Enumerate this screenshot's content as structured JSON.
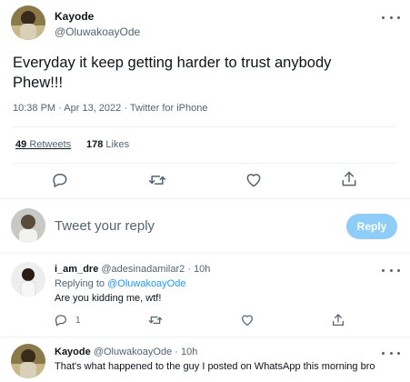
{
  "main_tweet": {
    "display_name": "Kayode",
    "handle": "@OluwakoayOde",
    "text_line1": "Everyday it keep getting harder to trust anybody",
    "text_line2": "Phew!!!",
    "time": "10:38 PM",
    "date": "Apr 13, 2022",
    "source": "Twitter for iPhone",
    "retweets_count": "49",
    "retweets_label": "Retweets",
    "likes_count": "178",
    "likes_label": "Likes"
  },
  "reply_box": {
    "placeholder": "Tweet your reply",
    "button_label": "Reply"
  },
  "replies": [
    {
      "display_name": "i_am_dre",
      "handle": "@adesinadamilar2",
      "time": "10h",
      "replying_prefix": "Replying to ",
      "replying_handle": "@OluwakoayOde",
      "text": "Are you kidding me, wtf!",
      "reply_count": "1"
    },
    {
      "display_name": "Kayode",
      "handle": "@OluwakoayOde",
      "time": "10h",
      "text": "That's what happened to the guy I posted on WhatsApp this morning bro"
    }
  ],
  "icons": {
    "more": "more-horizontal-icon",
    "reply": "reply-bubble-icon",
    "retweet": "retweet-icon",
    "like": "heart-icon",
    "share": "share-icon"
  },
  "colors": {
    "accent": "#1d9bf0",
    "reply_button_disabled": "#8ecdf8",
    "text": "#0f1419",
    "muted": "#536471",
    "divider": "#eff3f4"
  }
}
